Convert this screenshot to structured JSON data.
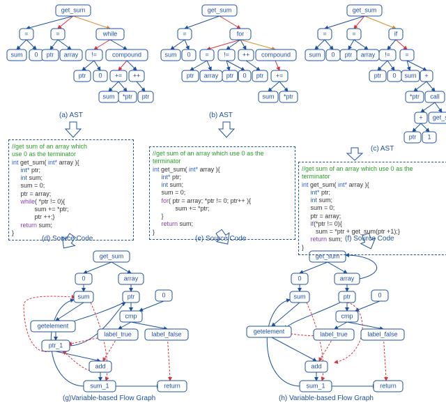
{
  "ast": {
    "a": {
      "root": "get_sum",
      "n_eq1": "=",
      "n_eq2": "=",
      "n_while": "while",
      "l_sum": "sum",
      "l_0": "0",
      "l_ptr": "ptr",
      "l_array": "array",
      "l_ne": "!=",
      "l_compound": "compound",
      "l_ptr2": "ptr",
      "l_02": "0",
      "l_pluse": "+=",
      "l_inc": "++",
      "l_sum2": "sum",
      "l_star": "*ptr",
      "l_ptr3": "ptr"
    },
    "b": {
      "root": "get_sum",
      "n_eq": "=",
      "n_for": "for",
      "l_sum": "sum",
      "l_0": "0",
      "l_eq": "=",
      "l_ne": "!=",
      "l_inc": "++",
      "l_compound": "compound",
      "l_ptr": "ptr",
      "l_array": "array",
      "l_ptr2": "ptr",
      "l_02": "0",
      "l_ptr3": "ptr",
      "l_pluse": "+=",
      "l_sum2": "sum",
      "l_star": "*ptr"
    },
    "c": {
      "root": "get_sum",
      "n_eq1": "=",
      "n_eq2": "=",
      "n_if": "if",
      "l_sum": "sum",
      "l_0": "0",
      "l_ptr": "ptr",
      "l_array": "array",
      "l_ne": "!=",
      "l_eq": "=",
      "l_ptr2": "ptr",
      "l_02": "0",
      "l_sum2": "sum",
      "l_plus": "+",
      "l_star": "*ptr",
      "l_call": "call",
      "l_plus2": "+",
      "l_gs": "get_sum",
      "l_ptr3": "ptr",
      "l_1": "1"
    }
  },
  "captions": {
    "a": "(a) AST",
    "b": "(b) AST",
    "c": "(c) AST",
    "d": "(d) Source Code",
    "e": "(e) Source Code",
    "f": "(f) Source Code",
    "g": "(g)Variable-based Flow Graph",
    "h": "(h) Variable-based Flow Graph"
  },
  "code": {
    "d": {
      "comment": "//get sum of an array which\nuse 0 as the terminator",
      "sig1": "int",
      "sig2": " get_sum(",
      "sig3": " int*",
      "sig4": " array ){",
      "decl1": "int*",
      "decl1b": " ptr;",
      "decl2": "int",
      "decl2b": " sum;",
      "l3": "sum = 0;",
      "l4": "ptr = array;",
      "l5a": "while",
      "l5b": "( *ptr != 0){",
      "l6": "sum += *ptr;",
      "l7": "ptr ++;}",
      "ret": "return",
      "retb": " sum;",
      "close": "}"
    },
    "e": {
      "comment": "//get sum of an array which use 0 as the\nterminator",
      "sig1": "int",
      "sig2": " get_sum(",
      "sig3": " int*",
      "sig4": " array ){",
      "decl1": "int*",
      "decl1b": " ptr;",
      "decl2": "int",
      "decl2b": " sum;",
      "l3": "sum = 0;",
      "l5a": "for",
      "l5b": "( ptr = array; *ptr != 0; ptr++ ){",
      "l6": "sum += *ptr;",
      "l7": "}",
      "ret": "return",
      "retb": " sum;",
      "close": "}"
    },
    "f": {
      "comment": "//get sum of an array which use 0 as the\nterminator",
      "sig1": "int",
      "sig2": " get_sum(",
      "sig3": " int*",
      "sig4": " array ){",
      "decl1": "int*",
      "decl1b": " ptr;",
      "decl2": "int",
      "decl2b": " sum;",
      "l3": "sum = 0;",
      "l4": "ptr = array;",
      "l5a": "if",
      "l5b": "(*ptr != 0){",
      "l6": "sum = *ptr + get_sum(ptr +1);}",
      "ret": "return",
      "retb": " sum;",
      "close": "}"
    }
  },
  "flow": {
    "get_sum": "get_sum",
    "n0": "0",
    "array": "array",
    "sum": "sum",
    "ptr": "ptr",
    "n0b": "0",
    "cmp": "cmp",
    "getelement": "getelement",
    "label_true": "label_true",
    "label_false": "label_false",
    "ptr_1": "ptr_1",
    "add": "add",
    "sum_1": "sum_1",
    "return": "return"
  }
}
